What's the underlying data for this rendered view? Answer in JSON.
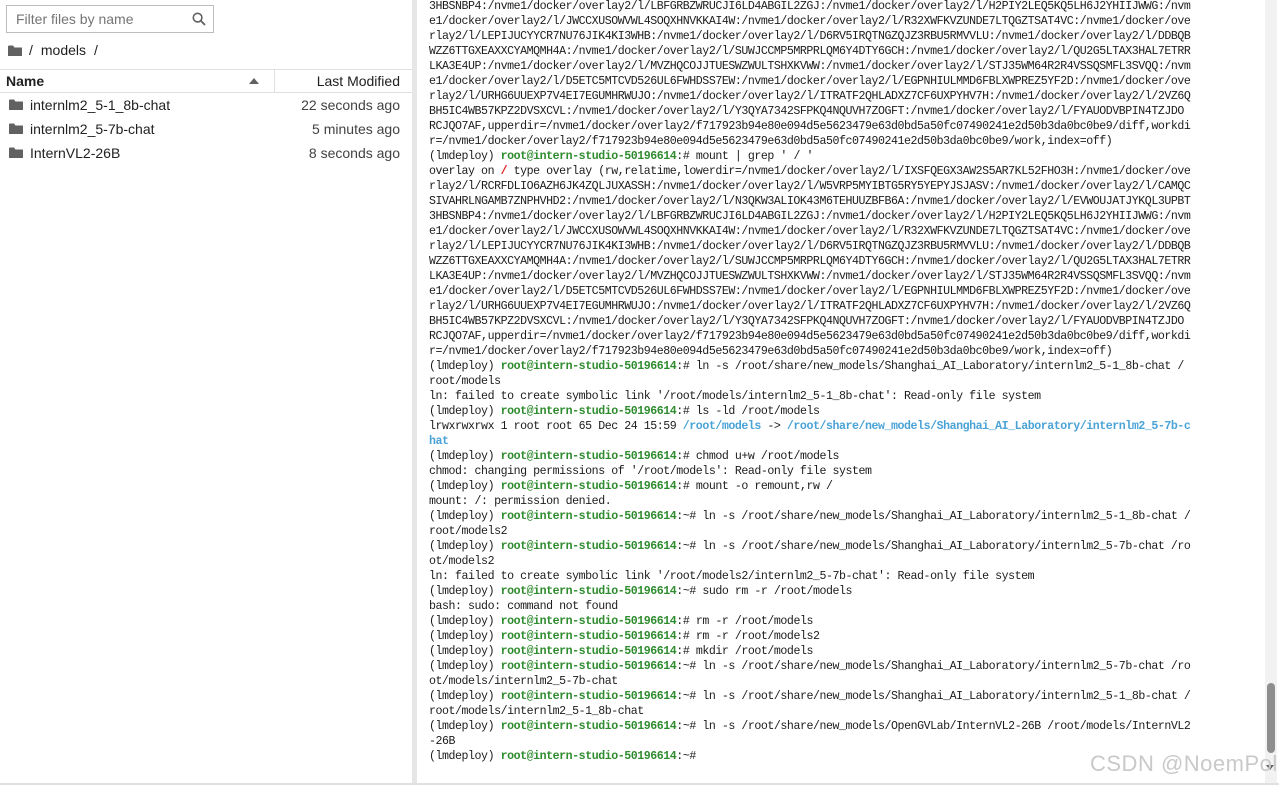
{
  "search": {
    "placeholder": "Filter files by name",
    "value": ""
  },
  "breadcrumb": {
    "root": "/",
    "folder": "models",
    "trail_sep": "/"
  },
  "columns": {
    "name": "Name",
    "modified": "Last Modified"
  },
  "files": [
    {
      "name": "internlm2_5-1_8b-chat",
      "modified": "22 seconds ago"
    },
    {
      "name": "internlm2_5-7b-chat",
      "modified": "5 minutes ago"
    },
    {
      "name": "InternVL2-26B",
      "modified": "8 seconds ago"
    }
  ],
  "terminal": {
    "env": "(lmdeploy)",
    "host": "root@intern-studio-50196614",
    "lines": [
      {
        "t": "plain",
        "text": "3HBSNBP4:/nvme1/docker/overlay2/l/LBFGRBZWRUCJI6LD4ABGIL2ZGJ:/nvme1/docker/overlay2/l/H2PIY2LEQ5KQ5LH6J2YHIIJWWG:/nvm"
      },
      {
        "t": "plain",
        "text": "e1/docker/overlay2/l/JWCCXUSOWVWL4SOQXHNVKKAI4W:/nvme1/docker/overlay2/l/R32XWFKVZUNDE7LTQGZTSAT4VC:/nvme1/docker/ove"
      },
      {
        "t": "plain",
        "text": "rlay2/l/LEPIJUCYYCR7NU76JIK4KI3WHB:/nvme1/docker/overlay2/l/D6RV5IRQTNGZQJZ3RBU5RMVVLU:/nvme1/docker/overlay2/l/DDBQB"
      },
      {
        "t": "plain",
        "text": "WZZ6TTGXEAXXCYAMQMH4A:/nvme1/docker/overlay2/l/SUWJCCMP5MRPRLQM6Y4DTY6GCH:/nvme1/docker/overlay2/l/QU2G5LTAX3HAL7ETRR"
      },
      {
        "t": "plain",
        "text": "LKA3E4UP:/nvme1/docker/overlay2/l/MVZHQCOJJTUESWZWULTSHXKVWW:/nvme1/docker/overlay2/l/STJ35WM64R2R4VSSQSMFL3SVQQ:/nvm"
      },
      {
        "t": "plain",
        "text": "e1/docker/overlay2/l/D5ETC5MTCVD526UL6FWHDSS7EW:/nvme1/docker/overlay2/l/EGPNHIULMMD6FBLXWPREZ5YF2D:/nvme1/docker/ove"
      },
      {
        "t": "plain",
        "text": "rlay2/l/URHG6UUEXP7V4EI7EGUMHRWUJO:/nvme1/docker/overlay2/l/ITRATF2QHLADXZ7CF6UXPYHV7H:/nvme1/docker/overlay2/l/2VZ6Q"
      },
      {
        "t": "plain",
        "text": "BH5IC4WB57KPZ2DVSXCVL:/nvme1/docker/overlay2/l/Y3QYA7342SFPKQ4NQUVH7ZOGFT:/nvme1/docker/overlay2/l/FYAUODVBPIN4TZJDO"
      },
      {
        "t": "plain",
        "text": "RCJQO7AF,upperdir=/nvme1/docker/overlay2/f717923b94e80e094d5e5623479e63d0bd5a50fc07490241e2d50b3da0bc0be9/diff,workdi"
      },
      {
        "t": "plain",
        "text": "r=/nvme1/docker/overlay2/f717923b94e80e094d5e5623479e63d0bd5a50fc07490241e2d50b3da0bc0be9/work,index=off)"
      },
      {
        "t": "prompt",
        "cmd": "# mount | grep ' / '"
      },
      {
        "t": "mount",
        "pre": "overlay on ",
        "red": "/",
        "post": " type overlay (rw,relatime,lowerdir=/nvme1/docker/overlay2/l/IXSFQEGX3AW2S5AR7KL52FHO3H:/nvme1/docker/ove"
      },
      {
        "t": "plain",
        "text": "rlay2/l/RCRFDLIO6AZH6JK4ZQLJUXASSH:/nvme1/docker/overlay2/l/W5VRP5MYIBTG5RY5YEPYJSJASV:/nvme1/docker/overlay2/l/CAMQC"
      },
      {
        "t": "plain",
        "text": "SIVAHRLNGAMB7ZNPHVHD2:/nvme1/docker/overlay2/l/N3QKW3ALIOK43M6TEHUUZBFB6A:/nvme1/docker/overlay2/l/EVWOUJATJYKQL3UPBT"
      },
      {
        "t": "plain",
        "text": "3HBSNBP4:/nvme1/docker/overlay2/l/LBFGRBZWRUCJI6LD4ABGIL2ZGJ:/nvme1/docker/overlay2/l/H2PIY2LEQ5KQ5LH6J2YHIIJWWG:/nvm"
      },
      {
        "t": "plain",
        "text": "e1/docker/overlay2/l/JWCCXUSOWVWL4SOQXHNVKKAI4W:/nvme1/docker/overlay2/l/R32XWFKVZUNDE7LTQGZTSAT4VC:/nvme1/docker/ove"
      },
      {
        "t": "plain",
        "text": "rlay2/l/LEPIJUCYYCR7NU76JIK4KI3WHB:/nvme1/docker/overlay2/l/D6RV5IRQTNGZQJZ3RBU5RMVVLU:/nvme1/docker/overlay2/l/DDBQB"
      },
      {
        "t": "plain",
        "text": "WZZ6TTGXEAXXCYAMQMH4A:/nvme1/docker/overlay2/l/SUWJCCMP5MRPRLQM6Y4DTY6GCH:/nvme1/docker/overlay2/l/QU2G5LTAX3HAL7ETRR"
      },
      {
        "t": "plain",
        "text": "LKA3E4UP:/nvme1/docker/overlay2/l/MVZHQCOJJTUESWZWULTSHXKVWW:/nvme1/docker/overlay2/l/STJ35WM64R2R4VSSQSMFL3SVQQ:/nvm"
      },
      {
        "t": "plain",
        "text": "e1/docker/overlay2/l/D5ETC5MTCVD526UL6FWHDSS7EW:/nvme1/docker/overlay2/l/EGPNHIULMMD6FBLXWPREZ5YF2D:/nvme1/docker/ove"
      },
      {
        "t": "plain",
        "text": "rlay2/l/URHG6UUEXP7V4EI7EGUMHRWUJO:/nvme1/docker/overlay2/l/ITRATF2QHLADXZ7CF6UXPYHV7H:/nvme1/docker/overlay2/l/2VZ6Q"
      },
      {
        "t": "plain",
        "text": "BH5IC4WB57KPZ2DVSXCVL:/nvme1/docker/overlay2/l/Y3QYA7342SFPKQ4NQUVH7ZOGFT:/nvme1/docker/overlay2/l/FYAUODVBPIN4TZJDO"
      },
      {
        "t": "plain",
        "text": "RCJQO7AF,upperdir=/nvme1/docker/overlay2/f717923b94e80e094d5e5623479e63d0bd5a50fc07490241e2d50b3da0bc0be9/diff,workdi"
      },
      {
        "t": "plain",
        "text": "r=/nvme1/docker/overlay2/f717923b94e80e094d5e5623479e63d0bd5a50fc07490241e2d50b3da0bc0be9/work,index=off)"
      },
      {
        "t": "prompt",
        "cmd": "# ln -s /root/share/new_models/Shanghai_AI_Laboratory/internlm2_5-1_8b-chat /"
      },
      {
        "t": "plain",
        "text": "root/models"
      },
      {
        "t": "plain",
        "text": "ln: failed to create symbolic link '/root/models/internlm2_5-1_8b-chat': Read-only file system"
      },
      {
        "t": "prompt",
        "cmd": "# ls -ld /root/models"
      },
      {
        "t": "ls",
        "pre": "lrwxrwxrwx 1 root root 65 Dec 24 15:59 ",
        "link": "/root/models",
        "arrow": " -> ",
        "target": "/root/share/new_models/Shanghai_AI_Laboratory/internlm2_5-7b-c"
      },
      {
        "t": "lscont",
        "text": "hat"
      },
      {
        "t": "prompt",
        "cmd": "# chmod u+w /root/models"
      },
      {
        "t": "plain",
        "text": "chmod: changing permissions of '/root/models': Read-only file system"
      },
      {
        "t": "prompt",
        "cmd": "# mount -o remount,rw /"
      },
      {
        "t": "plain",
        "text": "mount: /: permission denied."
      },
      {
        "t": "prompt",
        "cmd": "~# ln -s /root/share/new_models/Shanghai_AI_Laboratory/internlm2_5-1_8b-chat /"
      },
      {
        "t": "plain",
        "text": "root/models2"
      },
      {
        "t": "prompt",
        "cmd": "~# ln -s /root/share/new_models/Shanghai_AI_Laboratory/internlm2_5-7b-chat /ro"
      },
      {
        "t": "plain",
        "text": "ot/models2"
      },
      {
        "t": "plain",
        "text": "ln: failed to create symbolic link '/root/models2/internlm2_5-7b-chat': Read-only file system"
      },
      {
        "t": "prompt",
        "cmd": "~# sudo rm -r /root/models"
      },
      {
        "t": "plain",
        "text": "bash: sudo: command not found"
      },
      {
        "t": "prompt",
        "cmd": "# rm -r /root/models"
      },
      {
        "t": "prompt",
        "cmd": "# rm -r /root/models2"
      },
      {
        "t": "prompt",
        "cmd": "# mkdir /root/models"
      },
      {
        "t": "prompt",
        "cmd": "~# ln -s /root/share/new_models/Shanghai_AI_Laboratory/internlm2_5-7b-chat /ro"
      },
      {
        "t": "plain",
        "text": "ot/models/internlm2_5-7b-chat"
      },
      {
        "t": "prompt",
        "cmd": "~# ln -s /root/share/new_models/Shanghai_AI_Laboratory/internlm2_5-1_8b-chat /"
      },
      {
        "t": "plain",
        "text": "root/models/internlm2_5-1_8b-chat"
      },
      {
        "t": "prompt",
        "cmd": "~# ln -s /root/share/new_models/OpenGVLab/InternVL2-26B /root/models/InternVL2"
      },
      {
        "t": "plain",
        "text": "-26B"
      },
      {
        "t": "prompt",
        "cmd": "~# "
      }
    ]
  },
  "watermark": "CSDN @NoemPol",
  "colors": {
    "host": "#2e8b2e",
    "link": "#4aa3d6",
    "error_root": "#e02020"
  }
}
